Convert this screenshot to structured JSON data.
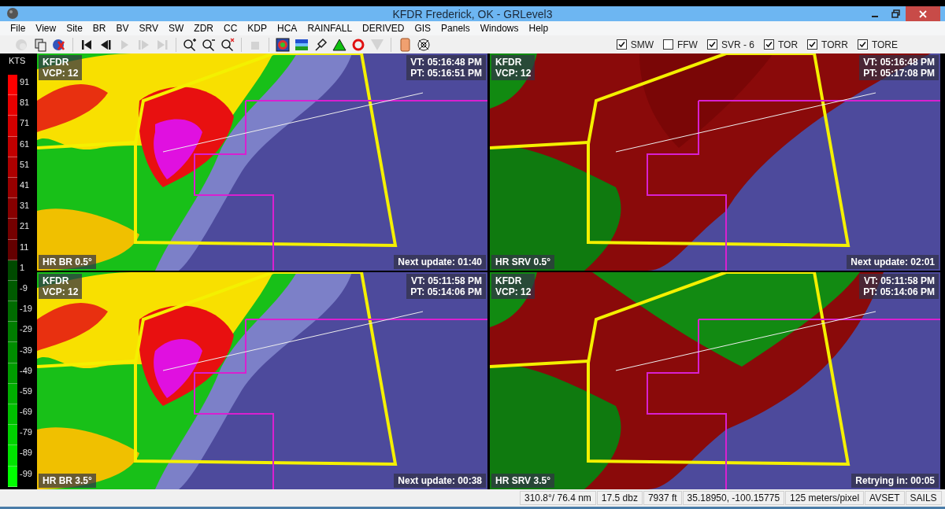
{
  "window": {
    "title": "KFDR Frederick, OK - GRLevel3"
  },
  "menu": [
    "File",
    "View",
    "Site",
    "BR",
    "BV",
    "SRV",
    "SW",
    "ZDR",
    "CC",
    "KDP",
    "HCA",
    "RAINFALL",
    "DERIVED",
    "GIS",
    "Panels",
    "Windows",
    "Help"
  ],
  "toolbar": {
    "groups": [
      {
        "items": [
          {
            "kind": "globe",
            "disabled": true
          },
          {
            "kind": "copy",
            "disabled": false
          },
          {
            "kind": "globe-x",
            "disabled": false
          }
        ]
      },
      {
        "items": [
          {
            "kind": "first",
            "disabled": false
          },
          {
            "kind": "back",
            "disabled": false
          },
          {
            "kind": "play",
            "disabled": true
          },
          {
            "kind": "forward",
            "disabled": true
          },
          {
            "kind": "last",
            "disabled": true
          }
        ]
      },
      {
        "items": [
          {
            "kind": "zoom-in",
            "disabled": false
          },
          {
            "kind": "zoom-out",
            "disabled": false
          },
          {
            "kind": "zoom-x",
            "disabled": false
          }
        ]
      },
      {
        "items": [
          {
            "kind": "stop",
            "disabled": true
          }
        ]
      },
      {
        "items": [
          {
            "kind": "radar",
            "disabled": false
          },
          {
            "kind": "layers",
            "disabled": false
          },
          {
            "kind": "pin",
            "disabled": false
          },
          {
            "kind": "triangle",
            "disabled": false
          },
          {
            "kind": "ring",
            "disabled": false
          },
          {
            "kind": "triangle-down",
            "disabled": true
          }
        ]
      },
      {
        "items": [
          {
            "kind": "tablet",
            "disabled": false
          },
          {
            "kind": "target",
            "disabled": false
          }
        ]
      }
    ]
  },
  "warning_filters": [
    {
      "label": "SMW",
      "checked": true
    },
    {
      "label": "FFW",
      "checked": false
    },
    {
      "label": "SVR - 6",
      "checked": true
    },
    {
      "label": "TOR",
      "checked": true
    },
    {
      "label": "TORR",
      "checked": true
    },
    {
      "label": "TORE",
      "checked": true
    }
  ],
  "legend": {
    "unit": "KTS",
    "items": [
      {
        "label": "91",
        "color": "#ff0000"
      },
      {
        "label": "81",
        "color": "#e80000"
      },
      {
        "label": "71",
        "color": "#d40000"
      },
      {
        "label": "61",
        "color": "#c00000"
      },
      {
        "label": "51",
        "color": "#ac0000"
      },
      {
        "label": "41",
        "color": "#980000"
      },
      {
        "label": "31",
        "color": "#860000"
      },
      {
        "label": "21",
        "color": "#740000"
      },
      {
        "label": "11",
        "color": "#640000"
      },
      {
        "label": "1",
        "color": "#004a00"
      },
      {
        "label": "-9",
        "color": "#005a00"
      },
      {
        "label": "-19",
        "color": "#006c00"
      },
      {
        "label": "-29",
        "color": "#007c00"
      },
      {
        "label": "-39",
        "color": "#008c00"
      },
      {
        "label": "-49",
        "color": "#009c00"
      },
      {
        "label": "-59",
        "color": "#00ae00"
      },
      {
        "label": "-69",
        "color": "#00c000"
      },
      {
        "label": "-79",
        "color": "#00d200"
      },
      {
        "label": "-89",
        "color": "#00e400"
      },
      {
        "label": "-99",
        "color": "#00ff00"
      }
    ]
  },
  "panels": [
    {
      "site": "KFDR",
      "vcp": "VCP: 12",
      "vt": "VT: 05:16:48 PM",
      "pt": "PT: 05:16:51 PM",
      "product": "HR BR 0.5°",
      "update": "Next update: 01:40"
    },
    {
      "site": "KFDR",
      "vcp": "VCP: 12",
      "vt": "VT: 05:16:48 PM",
      "pt": "PT: 05:17:08 PM",
      "product": "HR SRV 0.5°",
      "update": "Next update: 02:01"
    },
    {
      "site": "KFDR",
      "vcp": "VCP: 12",
      "vt": "VT: 05:11:58 PM",
      "pt": "PT: 05:14:06 PM",
      "product": "HR BR 3.5°",
      "update": "Next update: 00:38"
    },
    {
      "site": "KFDR",
      "vcp": "VCP: 12",
      "vt": "VT: 05:11:58 PM",
      "pt": "PT: 05:14:06 PM",
      "product": "HR SRV 3.5°",
      "update": "Retrying in: 00:05"
    }
  ],
  "status_bar": [
    "310.8°/ 76.4 nm",
    "17.5 dbz",
    "7937 ft",
    "35.18950, -100.15775",
    "125 meters/pixel",
    "AVSET",
    "SAILS"
  ]
}
